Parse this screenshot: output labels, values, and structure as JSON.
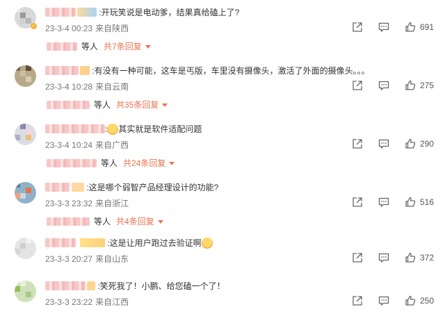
{
  "comments": [
    {
      "text": ":开玩笑说是电动爹，结果真给磕上了?",
      "date": "23-3-4 00:23",
      "location": "来自陕西",
      "likes": "691",
      "reply_suffix": "等人",
      "reply_more": "共7条回复",
      "verified": true,
      "emoji": false
    },
    {
      "text": ":有没有一种可能，这车是丐版，车里没有摄像头，激活了外面的摄像头。。。",
      "date": "23-3-4 10:28",
      "location": "来自云南",
      "likes": "275",
      "reply_suffix": "等人",
      "reply_more": "共35条回复",
      "verified": false,
      "emoji": false
    },
    {
      "text": "其实就是软件适配问题",
      "prefix": ":",
      "date": "23-3-4 10:24",
      "location": "来自广西",
      "likes": "290",
      "reply_suffix": "等人",
      "reply_more": "共24条回复",
      "verified": false,
      "emoji": true,
      "emoji_pos": "before"
    },
    {
      "text": ":这是哪个弱智产品经理设计的功能?",
      "date": "23-3-3 23:32",
      "location": "来自浙江",
      "likes": "516",
      "reply_suffix": "等人",
      "reply_more": "共4条回复",
      "verified": false,
      "emoji": false
    },
    {
      "text": ":这是让用户跑过去验证啊",
      "date": "23-3-3 20:27",
      "location": "来自山东",
      "likes": "372",
      "verified": false,
      "emoji": true,
      "emoji_pos": "after"
    },
    {
      "text": ":笑死我了！小鹏、给您磕一个了！",
      "date": "23-3-3 23:22",
      "location": "来自江西",
      "likes": "250",
      "verified": false,
      "emoji": false
    }
  ],
  "icons": {
    "share": "share-icon",
    "comment": "comment-icon",
    "like": "thumbs-up-icon",
    "caret": "caret-down-icon"
  },
  "colors": {
    "reply_link": "#eb7350",
    "meta_text": "#777777",
    "verified_badge": "#f6b23a"
  }
}
